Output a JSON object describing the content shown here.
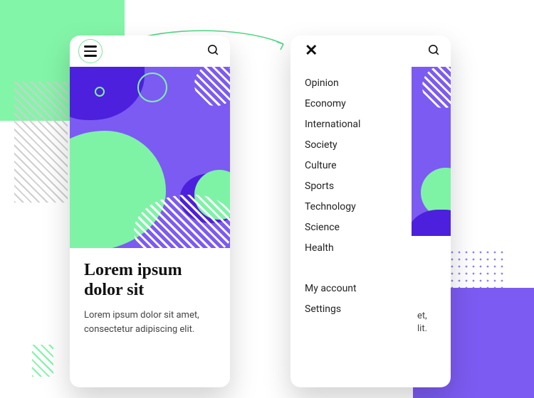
{
  "article": {
    "title": "Lorem ipsum dolor sit",
    "body": "Lorem ipsum dolor sit amet, consectetur adipiscing elit."
  },
  "rightPeek": {
    "line1": "et,",
    "line2": "lit."
  },
  "menu": {
    "items": [
      "Opinion",
      "Economy",
      "International",
      "Society",
      "Culture",
      "Sports",
      "Technology",
      "Science",
      "Health"
    ],
    "account": [
      "My account",
      "Settings"
    ]
  },
  "colors": {
    "accentGreen": "#7ef3a6",
    "accentPurple": "#7c5bf2",
    "darkPurple": "#4d20dd"
  }
}
